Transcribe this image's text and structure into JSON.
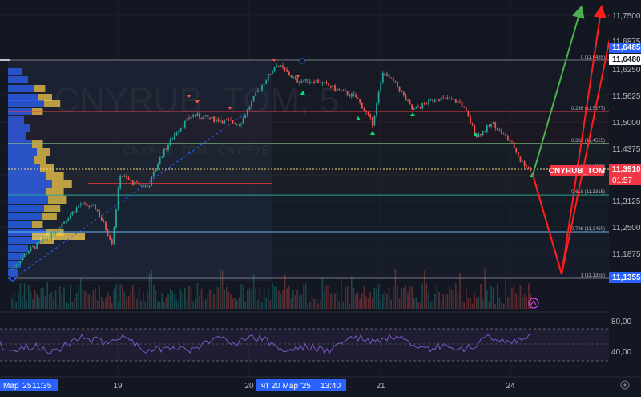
{
  "symbol": "CNYRUB_TOM",
  "symbol_tag": "CNYRUB_TOM",
  "watermark": {
    "main": "CNYRUB_TOM, 5",
    "sub": "CNYRUB_TOM - CNY/РУБ"
  },
  "colors": {
    "background": "#131722",
    "up": "#26a69a",
    "down": "#ef5350",
    "fib_grey": "#787b86",
    "fib_red": "#f23645",
    "fib_green": "#81c784",
    "fib_yellow": "#f7d77a",
    "fib_teal": "#26a69a",
    "fib_blue": "#64b5f6",
    "arrow_green": "#4caf50",
    "arrow_red": "#ff1e1e",
    "rsi": "#7e57c2",
    "highlight_blue": "#2962ff"
  },
  "price_axis": {
    "ticks": [
      "11,7500",
      "11,6875",
      "11,6250",
      "11,5625",
      "11,5000",
      "11,4375",
      "11,3750",
      "11,3125",
      "11,2500",
      "11,1875"
    ],
    "labels": {
      "upper_blue": "11,6485",
      "upper_white": "11,6480",
      "current_price": "11,3910",
      "countdown": "01:57",
      "lower_blue": "11,1355"
    }
  },
  "fib_levels": [
    {
      "label": "0 (11,6485)",
      "price": 11.6485,
      "color": "#787b86"
    },
    {
      "label": "0.236 (11,5277)",
      "price": 11.5277,
      "color": "#f23645"
    },
    {
      "label": "0.382 (11,4525)",
      "price": 11.4525,
      "color": "#81c784"
    },
    {
      "label": "0.5 (11,3920)",
      "price": 11.392,
      "color": "#f7d77a"
    },
    {
      "label": "0.618 (11,3315)",
      "price": 11.3315,
      "color": "#26a69a"
    },
    {
      "label": "0.786 (11,2450)",
      "price": 11.245,
      "color": "#64b5f6"
    },
    {
      "label": "1 (11,1355)",
      "price": 11.1355,
      "color": "#787b86"
    }
  ],
  "rsi_axis": {
    "upper": "80,00",
    "lower": "40,00"
  },
  "time_axis": {
    "labels": [
      "19",
      "20",
      "21",
      "24"
    ],
    "left_highlight": {
      "date": "Мар '25",
      "time": "11:35"
    },
    "crosshair": {
      "date": "чт 20 Мар '25",
      "time": "13:40"
    }
  }
}
